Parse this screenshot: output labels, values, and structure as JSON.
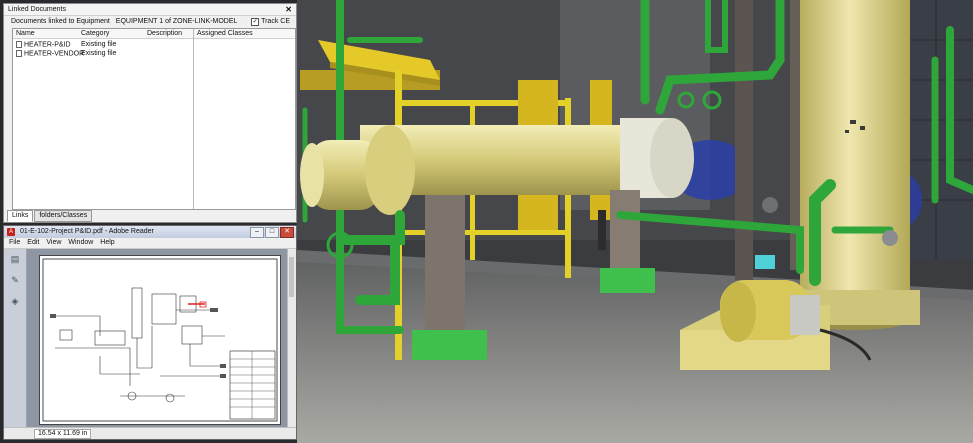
{
  "linked_documents": {
    "title": "Linked Documents",
    "close_label": "✕",
    "subheader_label": "Documents linked to Equipment",
    "equipment": "EQUIPMENT 1 of ZONE-LINK-MODEL",
    "track_label": "Track CE",
    "track_checked": "✓",
    "columns": [
      "Name",
      "Category",
      "Description"
    ],
    "rows": [
      {
        "name": "HEATER-P&ID",
        "category": "Existing file",
        "description": ""
      },
      {
        "name": "HEATER-VENDOR",
        "category": "Existing file",
        "description": ""
      }
    ],
    "assigned_header": "Assigned Classes",
    "tabs": [
      "Links",
      "folders/Classes"
    ]
  },
  "reader": {
    "title": "01-E-102-Project P&ID.pdf - Adobe Reader",
    "menu": [
      "File",
      "Edit",
      "View",
      "Window",
      "Help"
    ],
    "page_size": "16.54 x 11.69 in"
  },
  "colors": {
    "pipe_green": "#2fa63a",
    "vessel_yellow": "#d8cf7c",
    "railing_yellow": "#e3d12a",
    "floor": "#8a8a86"
  }
}
